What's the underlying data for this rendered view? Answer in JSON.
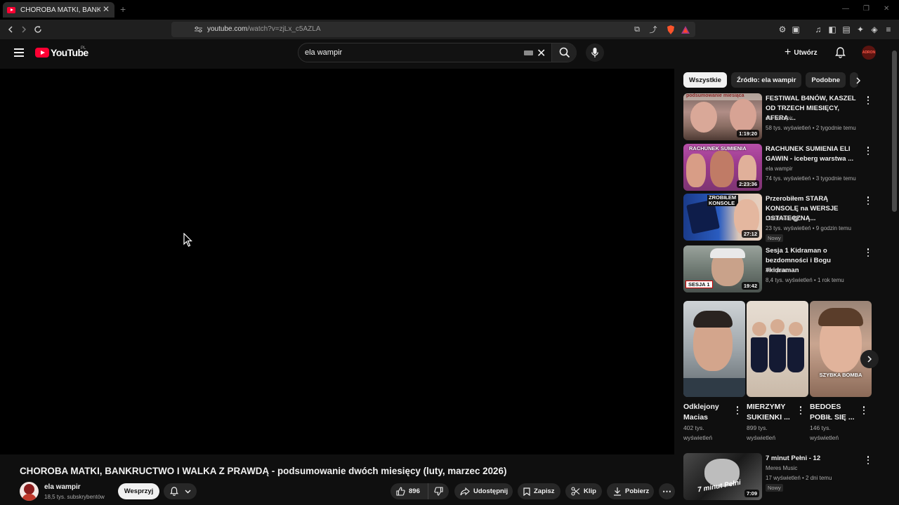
{
  "browser": {
    "tab_title": "CHOROBA MATKI, BANKRUCTWO I WALKA Z PRAWDĄ",
    "url_host": "youtube.com",
    "url_path": "/watch?v=zjLx_c5AZLA"
  },
  "masthead": {
    "logo_text": "YouTube",
    "country_code": "PL",
    "search_value": "ela wampir",
    "create_label": "Utwórz",
    "avatar_text": "ADRON"
  },
  "video": {
    "title": "CHOROBA MATKI, BANKRUCTWO I WALKA Z PRAWDĄ - podsumowanie dwóch miesięcy (luty, marzec 2026)",
    "channel_name": "ela wampir",
    "subscribers": "18,5 tys. subskrybentów",
    "support_label": "Wesprzyj",
    "likes": "896",
    "share_label": "Udostępnij",
    "save_label": "Zapisz",
    "clip_label": "Klip",
    "download_label": "Pobierz"
  },
  "chips": [
    "Wszystkie",
    "Źródło: ela wampir",
    "Podobne"
  ],
  "recommendations": [
    {
      "title": "FESTIWAL B4NÓW, KASZEL OD TRZECH MIESIĘCY, AFERA ...",
      "channel": "ela wampir",
      "meta": "58 tys. wyświetleń • 2 tygodnie temu",
      "duration": "1:19:20",
      "thumb_text": "podsumowanie miesiąca",
      "verified": false,
      "badge": ""
    },
    {
      "title": "RACHUNEK SUMIENIA ELI GAWIN - iceberg warstwa ...",
      "channel": "ela wampir",
      "meta": "74 tys. wyświetleń • 3 tygodnie temu",
      "duration": "2:23:36",
      "thumb_text": "RACHUNEK SUMIENIA",
      "verified": false,
      "badge": ""
    },
    {
      "title": "Przerobiłem STARĄ KONSOLĘ na WERSJE OSTATECZNĄ...",
      "channel": "DisStream",
      "meta": "23 tys. wyświetleń • 9 godzin temu",
      "duration": "27:12",
      "thumb_text": "ZROBIŁEM KONSOLE",
      "verified": true,
      "badge": "Nowy"
    },
    {
      "title": "Sesja 1 Kidraman o bezdomności i Bogu #kidraman",
      "channel": "Terapeuta",
      "meta": "8,4 tys. wyświetleń • 1 rok temu",
      "duration": "19:42",
      "thumb_text": "SESJA 1",
      "verified": false,
      "badge": ""
    }
  ],
  "shorts": [
    {
      "title": "Odklejony Macias",
      "views": "402 tys. wyświetleń",
      "thumb_text": ""
    },
    {
      "title": "MIERZYMY SUKIENKI ...",
      "views": "899 tys. wyświetleń",
      "thumb_text": ""
    },
    {
      "title": "BEDOES POBIŁ SIĘ ...",
      "views": "146 tys. wyświetleń",
      "thumb_text": "SZYBKA BOMBA"
    }
  ],
  "bottom_rec": {
    "title": "7 minut Pełni - 12",
    "channel": "Meres Music",
    "meta": "17 wyświetleń • 2 dni temu",
    "duration": "7:09",
    "badge": "Nowy",
    "thumb_text": "7 minut Pełni"
  },
  "colors": {
    "background": "#0f0f0f",
    "brand_red": "#ff0033",
    "chip_bg": "#272727",
    "secondary_text": "#aaaaaa"
  },
  "icons": [
    "menu-icon",
    "search-icon",
    "mic-icon",
    "bell-icon",
    "thumb-up-icon",
    "thumb-down-icon",
    "share-icon",
    "bookmark-icon",
    "scissors-icon",
    "download-icon",
    "more-icon",
    "chevron-right-icon"
  ]
}
